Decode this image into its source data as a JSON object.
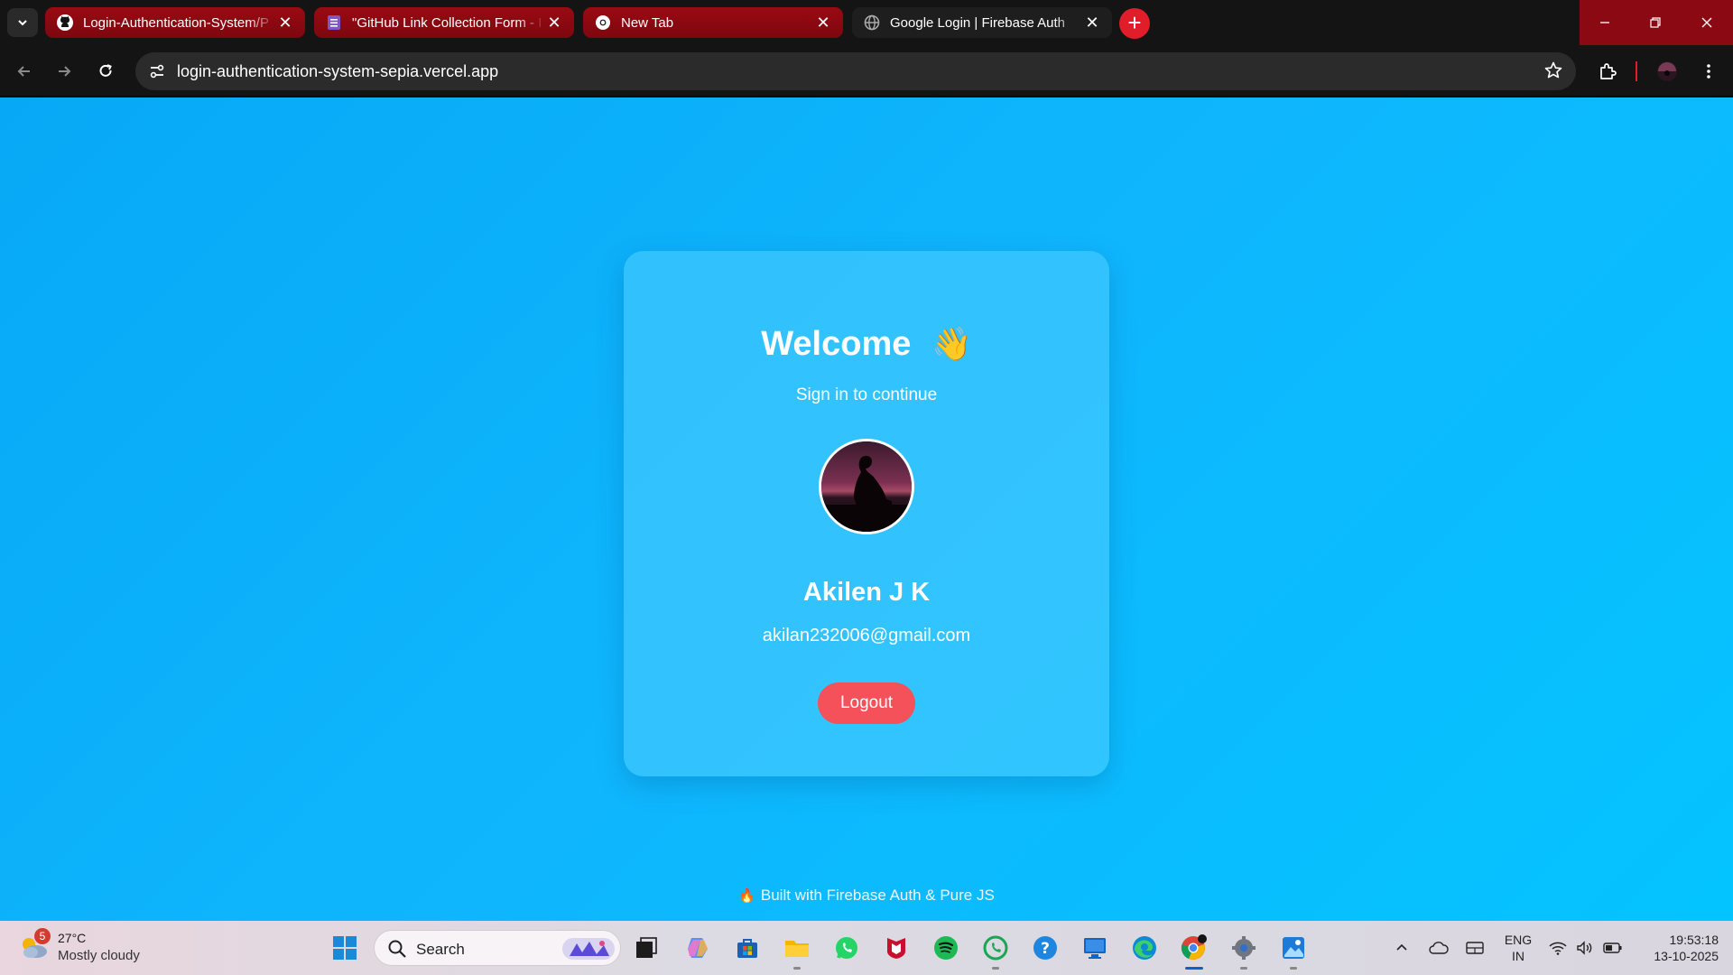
{
  "browser": {
    "tabs": [
      {
        "title": "Login-Authentication-System/P",
        "icon": "github-icon",
        "state": "inactive"
      },
      {
        "title": "\"GitHub Link Collection Form - I",
        "icon": "forms-icon",
        "state": "inactive"
      },
      {
        "title": "New Tab",
        "icon": "chrome-icon",
        "state": "inactive"
      },
      {
        "title": "Google Login | Firebase Auth",
        "icon": "globe-icon",
        "state": "active"
      }
    ],
    "url": "login-authentication-system-sepia.vercel.app",
    "accent_color": "#8a0912"
  },
  "page": {
    "title": "Welcome",
    "title_emoji": "👋",
    "subtitle": "Sign in to continue",
    "user_name": "Akilen J K",
    "user_email": "akilan232006@gmail.com",
    "logout_label": "Logout",
    "footer_icon": "🔥",
    "footer_text": "Built with Firebase Auth & Pure JS",
    "button_color": "#f4515a"
  },
  "taskbar": {
    "weather": {
      "badge": "5",
      "temp": "27°C",
      "condition": "Mostly cloudy"
    },
    "search_label": "Search",
    "apps": [
      "start-icon",
      "task-view-icon",
      "copilot-icon",
      "store-icon",
      "file-explorer-icon",
      "whatsapp-icon",
      "mcafee-icon",
      "spotify-icon",
      "whatsapp-beta-icon",
      "help-icon",
      "remote-desktop-icon",
      "edge-icon",
      "chrome-icon",
      "settings-icon",
      "photos-icon"
    ],
    "language": {
      "line1": "ENG",
      "line2": "IN"
    },
    "time": "19:53:18",
    "date": "13-10-2025"
  }
}
